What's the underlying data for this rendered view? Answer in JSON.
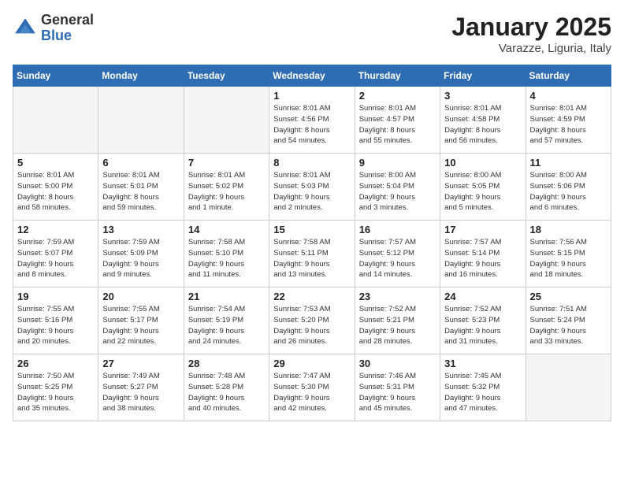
{
  "logo": {
    "general": "General",
    "blue": "Blue"
  },
  "title": "January 2025",
  "location": "Varazze, Liguria, Italy",
  "weekdays": [
    "Sunday",
    "Monday",
    "Tuesday",
    "Wednesday",
    "Thursday",
    "Friday",
    "Saturday"
  ],
  "weeks": [
    [
      {
        "day": "",
        "detail": ""
      },
      {
        "day": "",
        "detail": ""
      },
      {
        "day": "",
        "detail": ""
      },
      {
        "day": "1",
        "detail": "Sunrise: 8:01 AM\nSunset: 4:56 PM\nDaylight: 8 hours\nand 54 minutes."
      },
      {
        "day": "2",
        "detail": "Sunrise: 8:01 AM\nSunset: 4:57 PM\nDaylight: 8 hours\nand 55 minutes."
      },
      {
        "day": "3",
        "detail": "Sunrise: 8:01 AM\nSunset: 4:58 PM\nDaylight: 8 hours\nand 56 minutes."
      },
      {
        "day": "4",
        "detail": "Sunrise: 8:01 AM\nSunset: 4:59 PM\nDaylight: 8 hours\nand 57 minutes."
      }
    ],
    [
      {
        "day": "5",
        "detail": "Sunrise: 8:01 AM\nSunset: 5:00 PM\nDaylight: 8 hours\nand 58 minutes."
      },
      {
        "day": "6",
        "detail": "Sunrise: 8:01 AM\nSunset: 5:01 PM\nDaylight: 8 hours\nand 59 minutes."
      },
      {
        "day": "7",
        "detail": "Sunrise: 8:01 AM\nSunset: 5:02 PM\nDaylight: 9 hours\nand 1 minute."
      },
      {
        "day": "8",
        "detail": "Sunrise: 8:01 AM\nSunset: 5:03 PM\nDaylight: 9 hours\nand 2 minutes."
      },
      {
        "day": "9",
        "detail": "Sunrise: 8:00 AM\nSunset: 5:04 PM\nDaylight: 9 hours\nand 3 minutes."
      },
      {
        "day": "10",
        "detail": "Sunrise: 8:00 AM\nSunset: 5:05 PM\nDaylight: 9 hours\nand 5 minutes."
      },
      {
        "day": "11",
        "detail": "Sunrise: 8:00 AM\nSunset: 5:06 PM\nDaylight: 9 hours\nand 6 minutes."
      }
    ],
    [
      {
        "day": "12",
        "detail": "Sunrise: 7:59 AM\nSunset: 5:07 PM\nDaylight: 9 hours\nand 8 minutes."
      },
      {
        "day": "13",
        "detail": "Sunrise: 7:59 AM\nSunset: 5:09 PM\nDaylight: 9 hours\nand 9 minutes."
      },
      {
        "day": "14",
        "detail": "Sunrise: 7:58 AM\nSunset: 5:10 PM\nDaylight: 9 hours\nand 11 minutes."
      },
      {
        "day": "15",
        "detail": "Sunrise: 7:58 AM\nSunset: 5:11 PM\nDaylight: 9 hours\nand 13 minutes."
      },
      {
        "day": "16",
        "detail": "Sunrise: 7:57 AM\nSunset: 5:12 PM\nDaylight: 9 hours\nand 14 minutes."
      },
      {
        "day": "17",
        "detail": "Sunrise: 7:57 AM\nSunset: 5:14 PM\nDaylight: 9 hours\nand 16 minutes."
      },
      {
        "day": "18",
        "detail": "Sunrise: 7:56 AM\nSunset: 5:15 PM\nDaylight: 9 hours\nand 18 minutes."
      }
    ],
    [
      {
        "day": "19",
        "detail": "Sunrise: 7:55 AM\nSunset: 5:16 PM\nDaylight: 9 hours\nand 20 minutes."
      },
      {
        "day": "20",
        "detail": "Sunrise: 7:55 AM\nSunset: 5:17 PM\nDaylight: 9 hours\nand 22 minutes."
      },
      {
        "day": "21",
        "detail": "Sunrise: 7:54 AM\nSunset: 5:19 PM\nDaylight: 9 hours\nand 24 minutes."
      },
      {
        "day": "22",
        "detail": "Sunrise: 7:53 AM\nSunset: 5:20 PM\nDaylight: 9 hours\nand 26 minutes."
      },
      {
        "day": "23",
        "detail": "Sunrise: 7:52 AM\nSunset: 5:21 PM\nDaylight: 9 hours\nand 28 minutes."
      },
      {
        "day": "24",
        "detail": "Sunrise: 7:52 AM\nSunset: 5:23 PM\nDaylight: 9 hours\nand 31 minutes."
      },
      {
        "day": "25",
        "detail": "Sunrise: 7:51 AM\nSunset: 5:24 PM\nDaylight: 9 hours\nand 33 minutes."
      }
    ],
    [
      {
        "day": "26",
        "detail": "Sunrise: 7:50 AM\nSunset: 5:25 PM\nDaylight: 9 hours\nand 35 minutes."
      },
      {
        "day": "27",
        "detail": "Sunrise: 7:49 AM\nSunset: 5:27 PM\nDaylight: 9 hours\nand 38 minutes."
      },
      {
        "day": "28",
        "detail": "Sunrise: 7:48 AM\nSunset: 5:28 PM\nDaylight: 9 hours\nand 40 minutes."
      },
      {
        "day": "29",
        "detail": "Sunrise: 7:47 AM\nSunset: 5:30 PM\nDaylight: 9 hours\nand 42 minutes."
      },
      {
        "day": "30",
        "detail": "Sunrise: 7:46 AM\nSunset: 5:31 PM\nDaylight: 9 hours\nand 45 minutes."
      },
      {
        "day": "31",
        "detail": "Sunrise: 7:45 AM\nSunset: 5:32 PM\nDaylight: 9 hours\nand 47 minutes."
      },
      {
        "day": "",
        "detail": ""
      }
    ]
  ]
}
